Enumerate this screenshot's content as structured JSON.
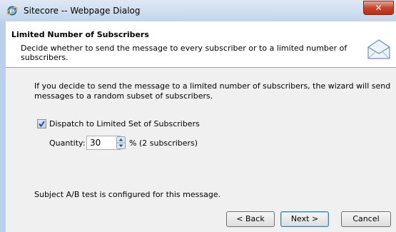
{
  "window": {
    "title": "Sitecore -- Webpage Dialog",
    "close_label": "✕"
  },
  "header": {
    "title": "Limited Number of Subscribers",
    "description": "Decide whether to send the message to every subscriber or to a limited number of subscribers."
  },
  "body": {
    "info_text": "If you decide to send the message to a limited number of subscribers, the wizard will send messages to a random subset of subscribers.",
    "dispatch_checkbox": {
      "label": "Dispatch to Limited Set of Subscribers",
      "checked": true
    },
    "quantity": {
      "label": "Quantity:",
      "value": "30",
      "suffix": "% (2 subscribers)"
    },
    "status_text": "Subject A/B test is configured for this message."
  },
  "buttons": {
    "back": "< Back",
    "next": "Next >",
    "cancel": "Cancel"
  },
  "colors": {
    "titlebar": "#c2d5ec",
    "close": "#c7452b",
    "dialog_bg": "#f0f0f0"
  }
}
